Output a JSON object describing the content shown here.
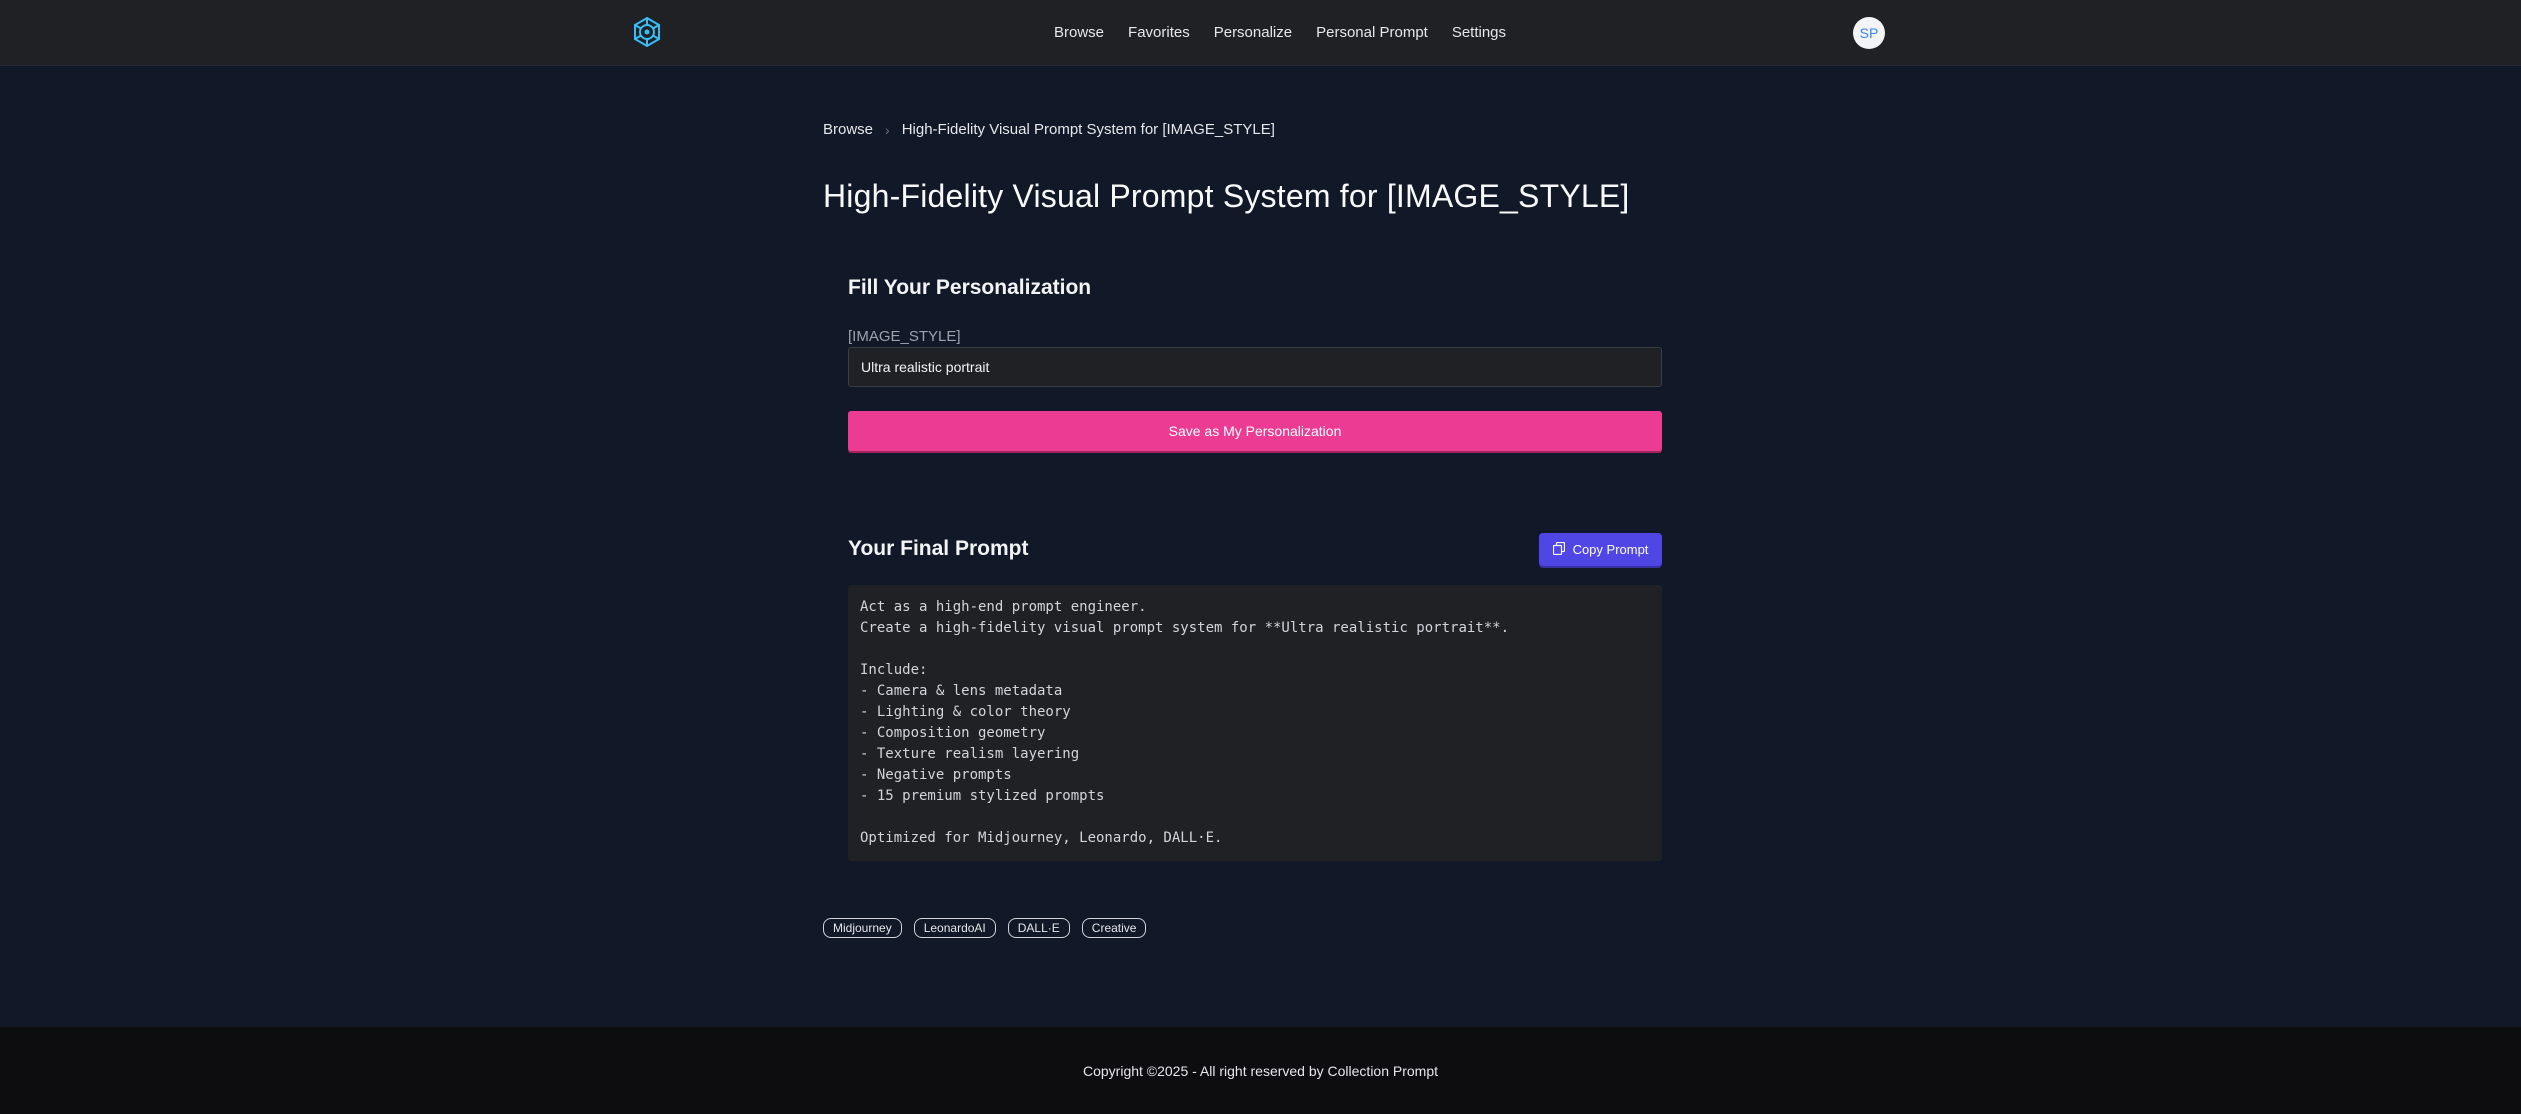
{
  "header": {
    "logo_icon": "gear-network-icon",
    "nav": [
      "Browse",
      "Favorites",
      "Personalize",
      "Personal Prompt",
      "Settings"
    ],
    "avatar_initials": "SP"
  },
  "breadcrumb": {
    "root": "Browse",
    "current": "High-Fidelity Visual Prompt System for [IMAGE_STYLE]"
  },
  "page": {
    "title": "High-Fidelity Visual Prompt System for [IMAGE_STYLE]"
  },
  "personalization": {
    "title": "Fill Your Personalization",
    "field_label": "[IMAGE_STYLE]",
    "field_value": "Ultra realistic portrait",
    "save_label": "Save as My Personalization"
  },
  "final_prompt": {
    "title": "Your Final Prompt",
    "copy_label": "Copy Prompt",
    "text": "Act as a high-end prompt engineer.\nCreate a high-fidelity visual prompt system for **Ultra realistic portrait**.\n\nInclude:\n- Camera & lens metadata\n- Lighting & color theory\n- Composition geometry\n- Texture realism layering\n- Negative prompts\n- 15 premium stylized prompts\n\nOptimized for Midjourney, Leonardo, DALL·E."
  },
  "tags": [
    "Midjourney",
    "LeonardoAI",
    "DALL·E",
    "Creative"
  ],
  "footer": {
    "copyright": "Copyright ©2025 - All right reserved by Collection Prompt"
  },
  "colors": {
    "accent_pink": "#ec3b92",
    "accent_indigo": "#4f46e5",
    "logo_blue": "#38bdf8",
    "background": "#111827"
  }
}
